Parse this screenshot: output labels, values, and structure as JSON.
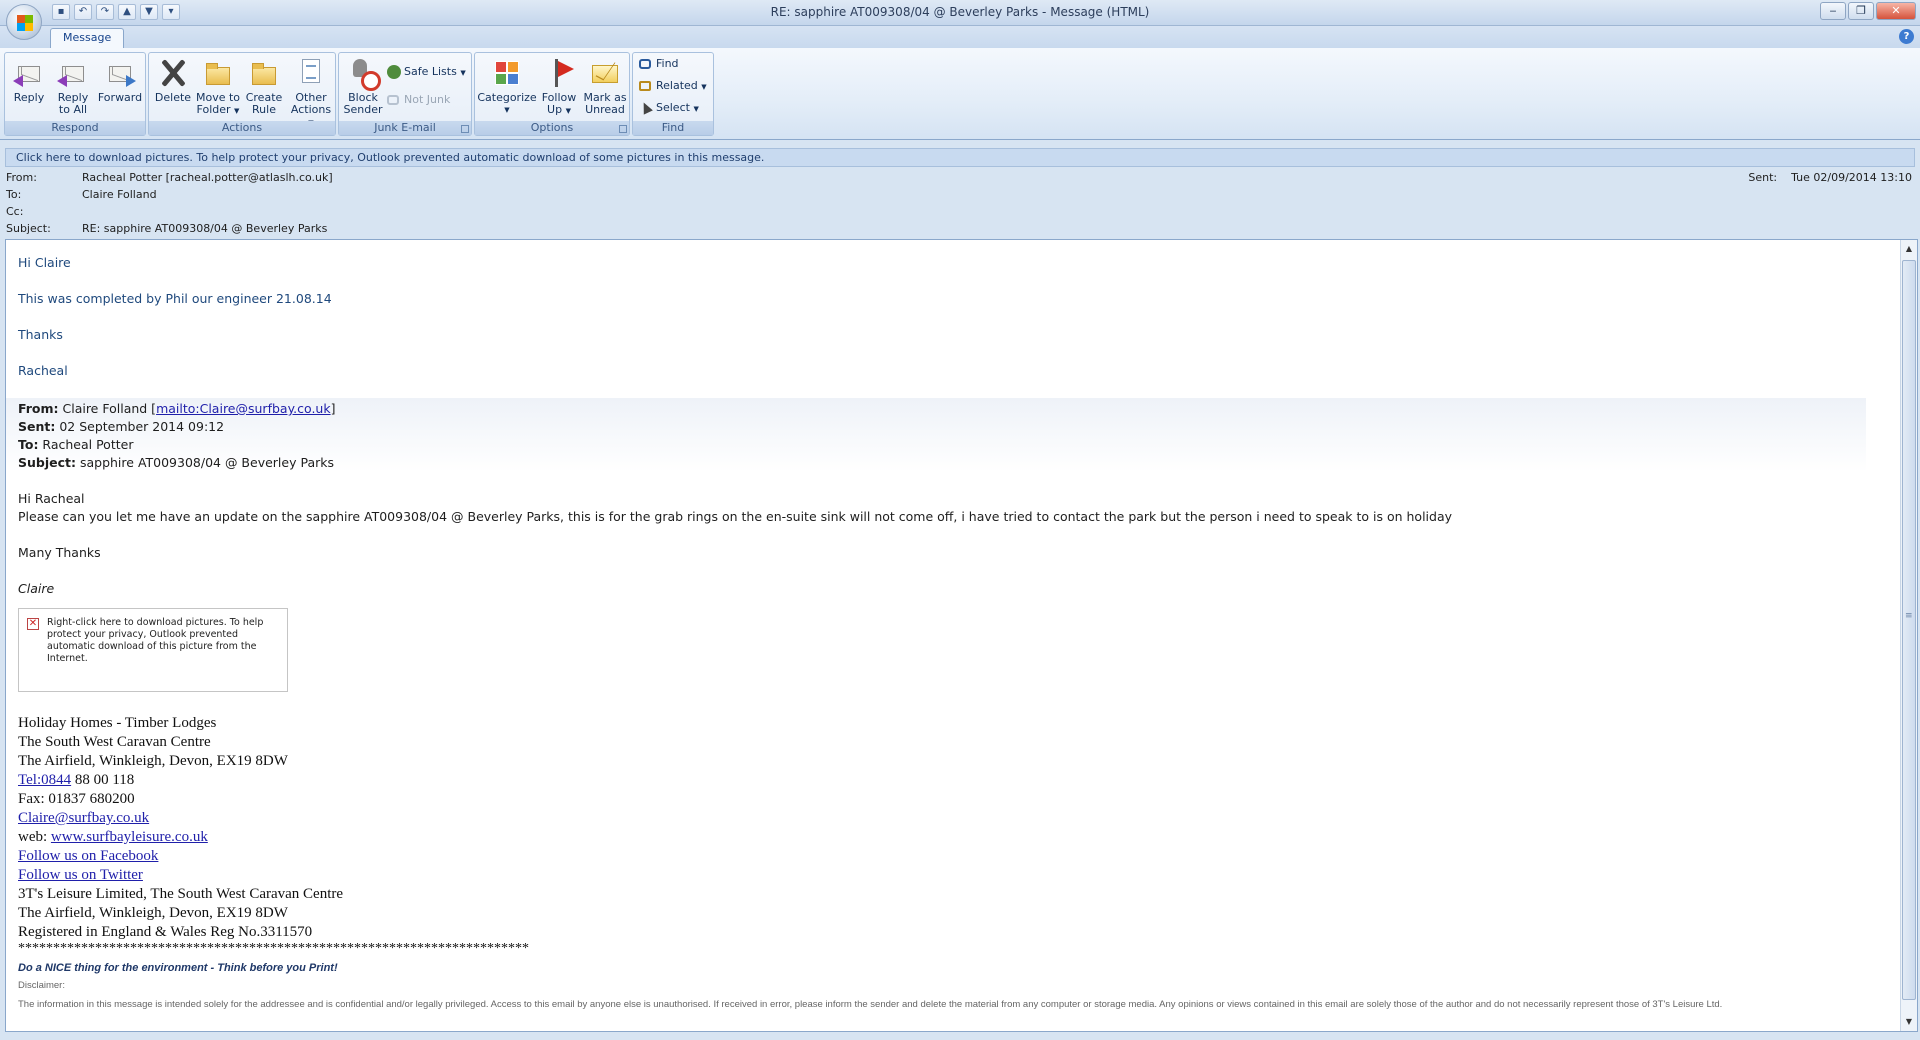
{
  "window": {
    "title": "RE: sapphire AT009308/04 @ Beverley Parks - Message (HTML)",
    "controls": [
      "‒",
      "❐",
      "✕"
    ]
  },
  "quick_access": [
    "save-icon",
    "undo-icon",
    "redo-icon",
    "previous-item-icon",
    "next-item-icon",
    "customize-icon"
  ],
  "tabs": [
    {
      "label": "Message"
    }
  ],
  "ribbon": {
    "respond": {
      "label": "Respond",
      "reply": "Reply",
      "reply_all_1": "Reply",
      "reply_all_2": "to All",
      "forward": "Forward"
    },
    "actions": {
      "label": "Actions",
      "delete": "Delete",
      "move_1": "Move to",
      "move_2": "Folder",
      "create_1": "Create",
      "create_2": "Rule",
      "other_1": "Other",
      "other_2": "Actions"
    },
    "junk": {
      "label": "Junk E-mail",
      "block_1": "Block",
      "block_2": "Sender",
      "safe_lists": "Safe Lists",
      "not_junk": "Not Junk"
    },
    "options": {
      "label": "Options",
      "categorize": "Categorize",
      "follow_1": "Follow",
      "follow_2": "Up",
      "mark_1": "Mark as",
      "mark_2": "Unread"
    },
    "find": {
      "label": "Find",
      "find": "Find",
      "related": "Related",
      "select": "Select"
    }
  },
  "infobar": "Click here to download pictures. To help protect your privacy, Outlook prevented automatic download of some pictures in this message.",
  "header": {
    "from_label": "From:",
    "from_value": "Racheal Potter [racheal.potter@atlaslh.co.uk]",
    "to_label": "To:",
    "to_value": "Claire Folland",
    "cc_label": "Cc:",
    "cc_value": "",
    "subject_label": "Subject:",
    "subject_value": "RE: sapphire AT009308/04 @ Beverley Parks",
    "sent_label": "Sent:",
    "sent_value": "Tue 02/09/2014 13:10"
  },
  "body": {
    "greeting": "Hi Claire",
    "line1": "This was completed by Phil our engineer 21.08.14",
    "thanks": "Thanks",
    "signoff": "Racheal",
    "quoted": {
      "from_label": "From:",
      "from_name": " Claire Folland [",
      "from_link": "mailto:Claire@surfbay.co.uk",
      "from_close": "]",
      "sent_label": "Sent:",
      "sent_value": " 02 September 2014 09:12",
      "to_label": "To:",
      "to_value": " Racheal Potter",
      "subject_label": "Subject:",
      "subject_value": " sapphire AT009308/04 @ Beverley Parks",
      "greeting": "Hi Racheal",
      "text": "Please can you let me have an update on the sapphire AT009308/04 @ Beverley Parks, this is for the grab rings on the en-suite sink will not come off, i have tried to contact the park but the person i need to speak to is on holiday",
      "many_thanks": "Many Thanks",
      "name": "Claire",
      "image_placeholder": "Right-click here to download pictures.  To help protect your privacy, Outlook prevented automatic download of this picture from the Internet."
    },
    "signature": {
      "line1": "Holiday Homes - Timber Lodges",
      "line2": "The South West Caravan Centre",
      "line3": "The Airfield, Winkleigh, Devon, EX19 8DW",
      "tel_link": "Tel:0844",
      "tel_rest": " 88 00 118",
      "fax": "Fax: 01837 680200",
      "email": "Claire@surfbay.co.uk",
      "web_label": "web: ",
      "web_link": "www.surfbayleisure.co.uk",
      "facebook": "Follow us on Facebook",
      "twitter": "Follow us on Twitter",
      "company": "3T's Leisure Limited, The South West Caravan Centre",
      "address": "The Airfield, Winkleigh, Devon, EX19 8DW",
      "reg": "Registered in England & Wales Reg No.3311570",
      "stars": "*************************************************************************",
      "nice": "Do a NICE thing for the environment - Think before you Print!",
      "disclaimer_label": "Disclaimer:",
      "disclaimer": "The information in this message is intended solely for the addressee and is confidential and/or legally privileged. Access to this email by anyone else is unauthorised. If received in error, please inform the sender and delete the material from any computer or storage media. Any opinions or views contained in this email are solely those of the author and do not necessarily represent those of  3T's Leisure Ltd."
    }
  }
}
